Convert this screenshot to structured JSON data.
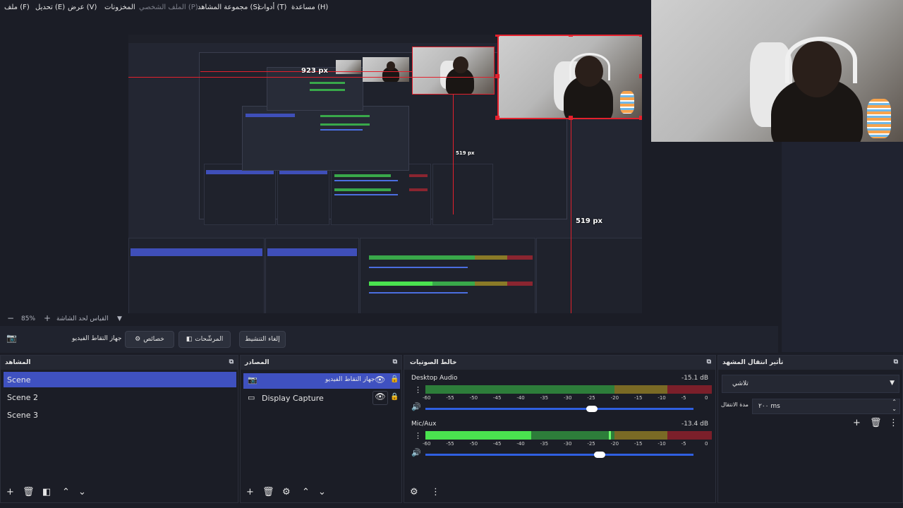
{
  "menu": {
    "file": "ملف (F)",
    "edit": "تحديل (E)",
    "view": "عرض (V)",
    "docks": "المخزونات",
    "profile": "الملف الشخصي (P)",
    "scene_collection": "مجموعة المشاهد (S)",
    "tools": "أدوات (T)",
    "help": "مساعدة (H)"
  },
  "preview": {
    "label_923": "923 px",
    "label_519_small": "519 px",
    "label_519": "519 px"
  },
  "zoom": {
    "minus": "−",
    "value": "85%",
    "plus": "+",
    "fit_label": "القياس لحد الشاشة",
    "dropdown": "▼"
  },
  "controls": {
    "source_name": "جهاز التقاط الفيديو",
    "properties": "خصائص",
    "filters": "المرشّحات",
    "deactivate": "إلغاء التنشيط"
  },
  "scenes": {
    "title": "المشاهد",
    "items": [
      "Scene",
      "Scene 2",
      "Scene 3"
    ]
  },
  "sources": {
    "title": "المصادر",
    "items": [
      "جهاز التقاط الفيديو",
      "Display Capture"
    ]
  },
  "mixer": {
    "title": "خالط الصوتيات",
    "channels": [
      {
        "name": "Desktop Audio",
        "db": "-15.1 dB",
        "level": 0.0,
        "volume": 0.6
      },
      {
        "name": "Mic/Aux",
        "db": "-13.4 dB",
        "level": 0.37,
        "volume": 0.63
      }
    ],
    "ticks": [
      "-60",
      "-55",
      "-50",
      "-45",
      "-40",
      "-35",
      "-30",
      "-25",
      "-20",
      "-15",
      "-10",
      "-5",
      "0"
    ]
  },
  "transitions": {
    "title": "تأثير انتقال المشهد",
    "selected": "تلاشي",
    "duration_label": "مدة الانتقال",
    "duration_value": "٢٠٠ ms"
  }
}
